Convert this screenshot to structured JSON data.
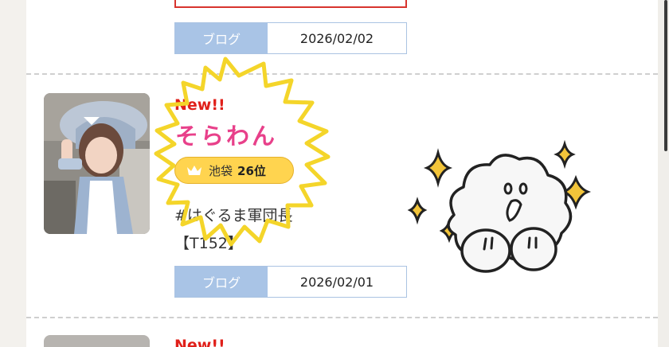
{
  "entries": [
    {
      "blog_label": "ブログ",
      "blog_date": "2026/02/02"
    },
    {
      "new_label": "New!!",
      "name": "そらわん",
      "rank_area": "池袋",
      "rank_value": "26位",
      "profile_line1": "#はぐるま軍団長",
      "profile_line2": "【T152】",
      "blog_label": "ブログ",
      "blog_date": "2026/02/01"
    },
    {
      "new_label": "New!!"
    }
  ],
  "colors": {
    "new": "#e0201a",
    "name": "#e8408a",
    "rank_pill": "#ffd44f",
    "blog_label_bg": "#a9c4e6",
    "sticker_burst": "#f4d52a"
  },
  "icons": [
    "crown-icon",
    "burst-sticker",
    "cloud-character-sticker",
    "sparkle-icon"
  ]
}
